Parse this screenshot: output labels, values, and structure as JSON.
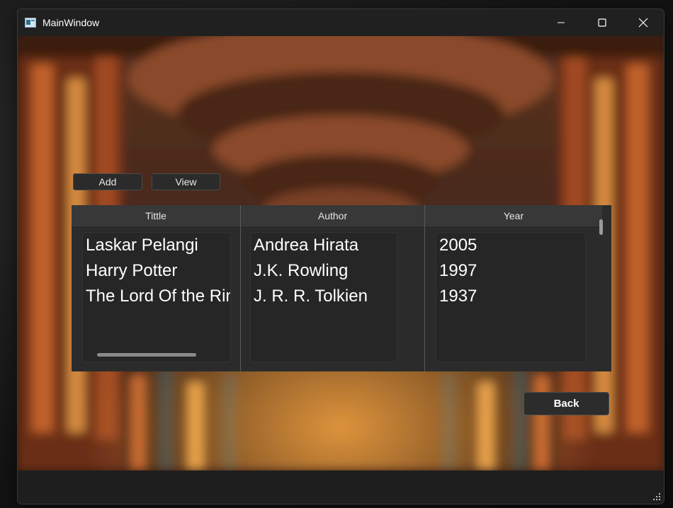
{
  "window": {
    "title": "MainWindow"
  },
  "toolbar": {
    "add_label": "Add",
    "view_label": "View"
  },
  "table": {
    "columns": [
      "Tittle",
      "Author",
      "Year"
    ],
    "rows": [
      {
        "title": "Laskar Pelangi",
        "author": "Andrea Hirata",
        "year": "2005"
      },
      {
        "title": "Harry Potter",
        "author": "J.K. Rowling",
        "year": "1997"
      },
      {
        "title": "The Lord Of the Rings",
        "author": "J. R. R. Tolkien",
        "year": "1937"
      }
    ]
  },
  "back_label": "Back",
  "colors": {
    "window_bg": "#202020",
    "panel_bg": "#2b2b2b",
    "header_bg": "#383838",
    "text": "#ffffff"
  },
  "icons": [
    "app-icon",
    "minimize-icon",
    "maximize-icon",
    "close-icon",
    "resize-grip-icon"
  ]
}
